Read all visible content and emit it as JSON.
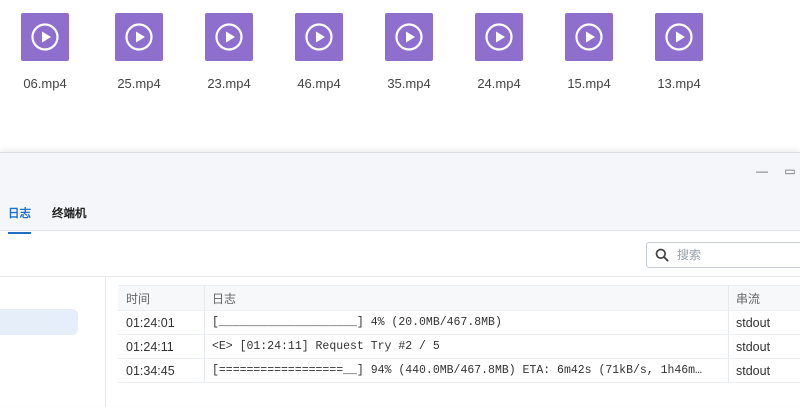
{
  "files": [
    {
      "name": "06.mp4",
      "icon": "video-file-icon"
    },
    {
      "name": "25.mp4",
      "icon": "video-file-icon"
    },
    {
      "name": "23.mp4",
      "icon": "video-file-icon"
    },
    {
      "name": "46.mp4",
      "icon": "video-file-icon"
    },
    {
      "name": "35.mp4",
      "icon": "video-file-icon"
    },
    {
      "name": "24.mp4",
      "icon": "video-file-icon"
    },
    {
      "name": "15.mp4",
      "icon": "video-file-icon"
    },
    {
      "name": "13.mp4",
      "icon": "video-file-icon"
    }
  ],
  "window": {
    "minimize_glyph": "—",
    "maximize_glyph": "▭"
  },
  "tabs": [
    {
      "label": "日志",
      "active": true
    },
    {
      "label": "终端机",
      "active": false
    }
  ],
  "search": {
    "placeholder": "搜索"
  },
  "table": {
    "columns": [
      "时间",
      "日志",
      "串流"
    ],
    "rows": [
      {
        "time": "01:24:01",
        "log": "[____________________] 4% (20.0MB/467.8MB)",
        "stream": "stdout"
      },
      {
        "time": "01:24:11",
        "log": "<E> [01:24:11] Request Try #2 / 5",
        "stream": "stdout"
      },
      {
        "time": "01:34:45",
        "log": "[==================__] 94% (440.0MB/467.8MB) ETA: 6m42s (71kB/s, 1h46m…",
        "stream": "stdout"
      }
    ]
  },
  "colors": {
    "file_icon_bg": "#8f6fce",
    "accent": "#1f6fc7"
  }
}
